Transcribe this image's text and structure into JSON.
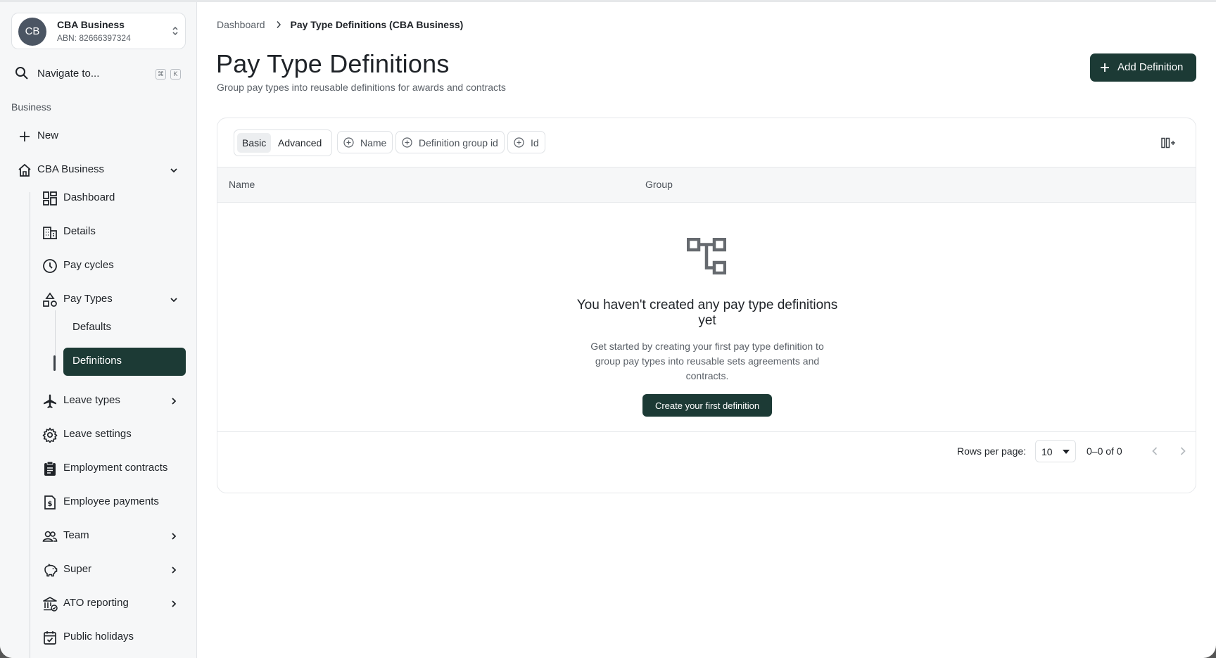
{
  "org": {
    "initials": "CB",
    "name": "CBA Business",
    "abn": "ABN: 82666397324"
  },
  "navigate": {
    "label": "Navigate to...",
    "kbd1": "⌘",
    "kbd2": "K"
  },
  "sidebar": {
    "section": "Business",
    "new_label": "New",
    "business_label": "CBA Business",
    "items": [
      {
        "label": "Dashboard",
        "icon": "dashboard-icon"
      },
      {
        "label": "Details",
        "icon": "building-icon"
      },
      {
        "label": "Pay cycles",
        "icon": "clock-icon"
      },
      {
        "label": "Pay Types",
        "icon": "shapes-icon"
      },
      {
        "label": "Leave types",
        "icon": "plane-icon"
      },
      {
        "label": "Leave settings",
        "icon": "gear-icon"
      },
      {
        "label": "Employment contracts",
        "icon": "clipboard-icon"
      },
      {
        "label": "Employee payments",
        "icon": "dollar-file-icon"
      },
      {
        "label": "Team",
        "icon": "people-icon"
      },
      {
        "label": "Super",
        "icon": "piggy-bank-icon"
      },
      {
        "label": "ATO reporting",
        "icon": "bank-icon"
      },
      {
        "label": "Public holidays",
        "icon": "calendar-check-icon"
      }
    ],
    "pay_types_sub": [
      {
        "label": "Defaults"
      },
      {
        "label": "Definitions"
      }
    ]
  },
  "breadcrumb": {
    "root": "Dashboard",
    "current": "Pay Type Definitions (CBA Business)"
  },
  "page": {
    "title": "Pay Type Definitions",
    "subtitle": "Group pay types into reusable definitions for awards and contracts",
    "add_button": "Add Definition"
  },
  "filters": {
    "basic": "Basic",
    "advanced": "Advanced",
    "chips": [
      "Name",
      "Definition group id",
      "Id"
    ]
  },
  "table": {
    "columns": [
      "Name",
      "Group"
    ]
  },
  "empty_state": {
    "title": "You haven't created any pay type definitions yet",
    "description": "Get started by creating your first pay type definition to group pay types into reusable sets agreements and contracts.",
    "button": "Create your first definition"
  },
  "pagination": {
    "rows_label": "Rows per page:",
    "rows_value": "10",
    "range": "0–0 of 0"
  },
  "colors": {
    "accent": "#1c3a35",
    "sidebar_bg": "#f6f7f8"
  }
}
